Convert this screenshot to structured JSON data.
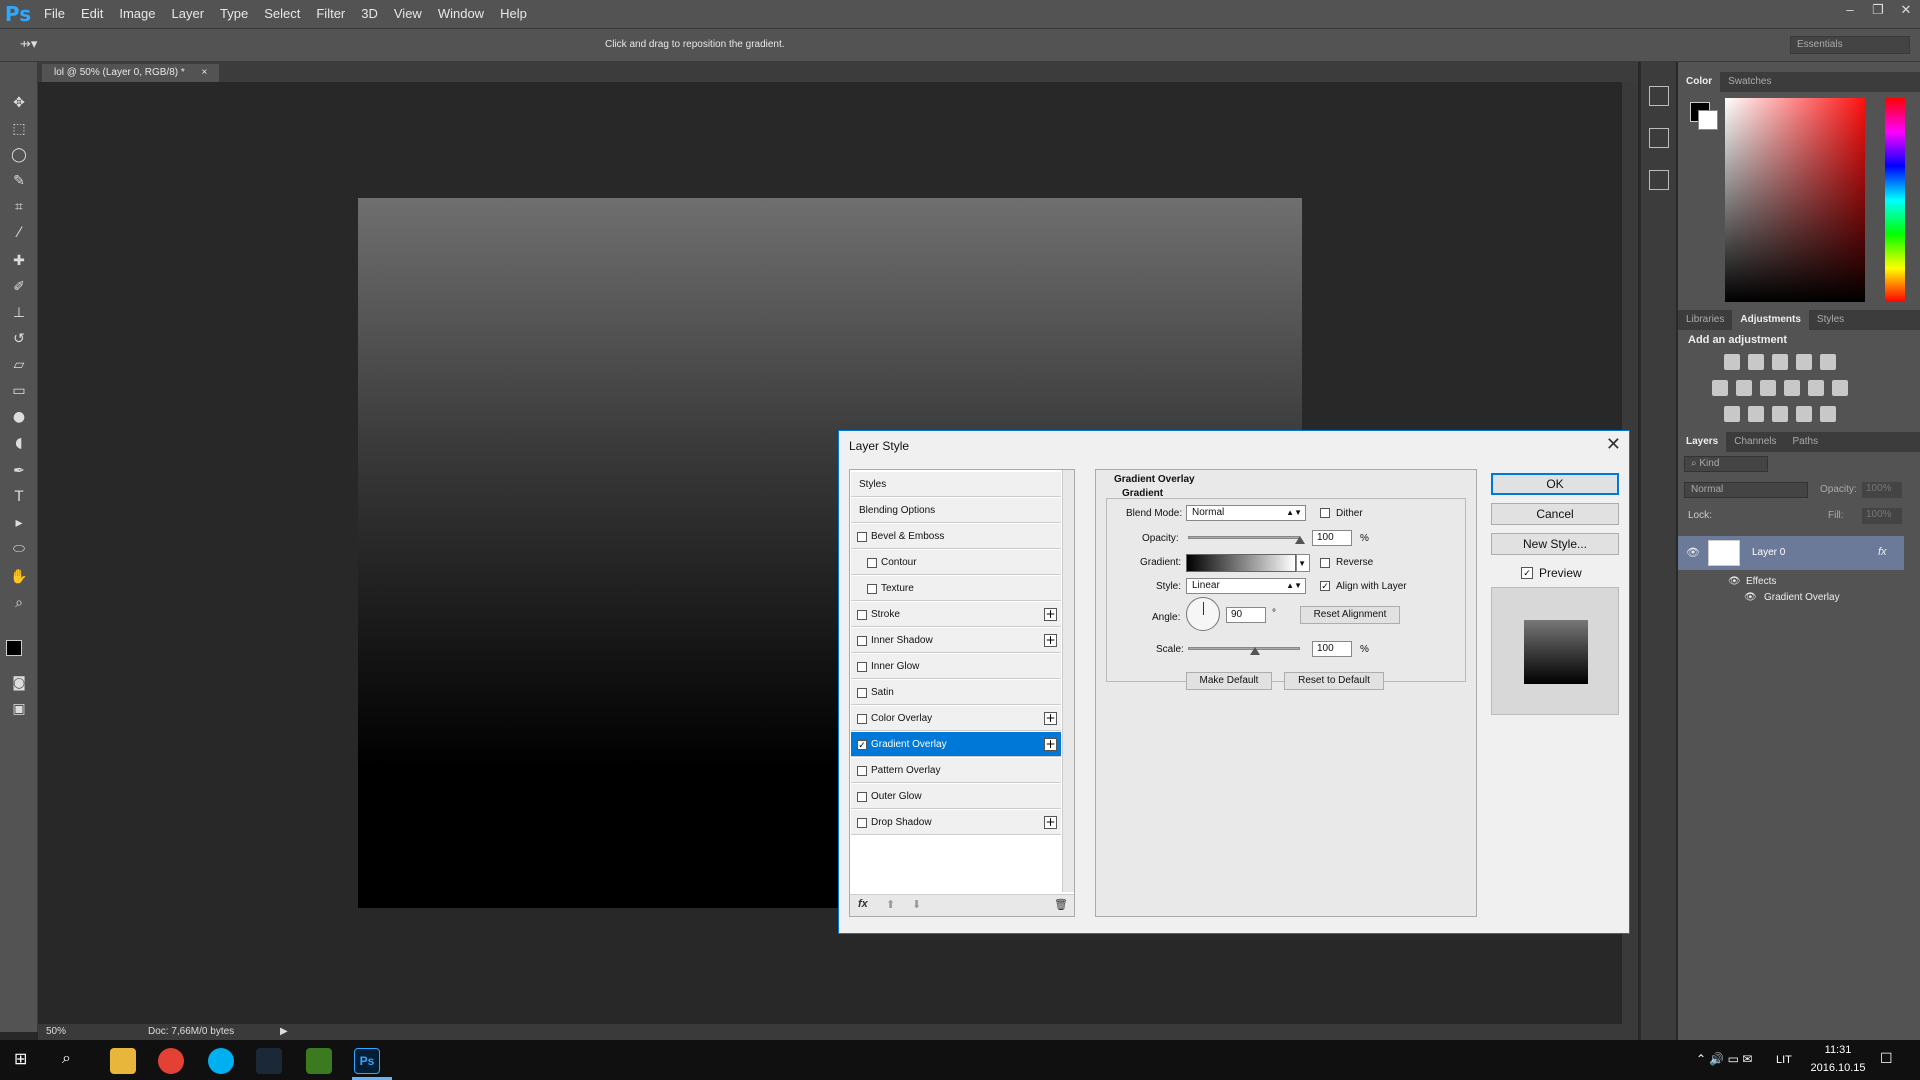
{
  "app": {
    "logo": "Ps",
    "menu": [
      "File",
      "Edit",
      "Image",
      "Layer",
      "Type",
      "Select",
      "Filter",
      "3D",
      "View",
      "Window",
      "Help"
    ],
    "window_controls": [
      "–",
      "❐",
      "✕"
    ]
  },
  "options": {
    "hint": "Click and drag to reposition the gradient.",
    "workspace": "Essentials"
  },
  "document": {
    "tab_title": "lol @ 50% (Layer 0, RGB/8) *",
    "tab_close": "×",
    "zoom": "50%",
    "doc_info": "Doc: 7,66M/0 bytes"
  },
  "color_panel": {
    "tabs": [
      "Color",
      "Swatches"
    ],
    "foreground": "#000000",
    "background": "#ffffff"
  },
  "adjustments_panel": {
    "tabs": [
      "Libraries",
      "Adjustments",
      "Styles"
    ],
    "heading": "Add an adjustment"
  },
  "layers_panel": {
    "tabs": [
      "Layers",
      "Channels",
      "Paths"
    ],
    "filter": "Kind",
    "blend_mode": "Normal",
    "opacity_label": "Opacity:",
    "opacity_value": "100%",
    "lock_label": "Lock:",
    "fill_label": "Fill:",
    "fill_value": "100%",
    "layer_name": "Layer 0",
    "fx": "fx",
    "effects_label": "Effects",
    "effect_name": "Gradient Overlay"
  },
  "taskbar": {
    "language": "LIT",
    "time": "11:31",
    "date": "2016.10.15"
  },
  "dialog": {
    "title": "Layer Style",
    "close": "✕",
    "styles_list": [
      {
        "label": "Styles",
        "checkbox": false,
        "checked": false,
        "plus": false,
        "indent": false
      },
      {
        "label": "Blending Options",
        "checkbox": false,
        "checked": false,
        "plus": false,
        "indent": false
      },
      {
        "label": "Bevel & Emboss",
        "checkbox": true,
        "checked": false,
        "plus": false,
        "indent": false
      },
      {
        "label": "Contour",
        "checkbox": true,
        "checked": false,
        "plus": false,
        "indent": true
      },
      {
        "label": "Texture",
        "checkbox": true,
        "checked": false,
        "plus": false,
        "indent": true
      },
      {
        "label": "Stroke",
        "checkbox": true,
        "checked": false,
        "plus": true,
        "indent": false
      },
      {
        "label": "Inner Shadow",
        "checkbox": true,
        "checked": false,
        "plus": true,
        "indent": false
      },
      {
        "label": "Inner Glow",
        "checkbox": true,
        "checked": false,
        "plus": false,
        "indent": false
      },
      {
        "label": "Satin",
        "checkbox": true,
        "checked": false,
        "plus": false,
        "indent": false
      },
      {
        "label": "Color Overlay",
        "checkbox": true,
        "checked": false,
        "plus": true,
        "indent": false
      },
      {
        "label": "Gradient Overlay",
        "checkbox": true,
        "checked": true,
        "plus": true,
        "indent": false
      },
      {
        "label": "Pattern Overlay",
        "checkbox": true,
        "checked": false,
        "plus": false,
        "indent": false
      },
      {
        "label": "Outer Glow",
        "checkbox": true,
        "checked": false,
        "plus": false,
        "indent": false
      },
      {
        "label": "Drop Shadow",
        "checkbox": true,
        "checked": false,
        "plus": true,
        "indent": false
      }
    ],
    "footer_fx": "fx",
    "settings": {
      "section_title": "Gradient Overlay",
      "group_title": "Gradient",
      "blend_mode_label": "Blend Mode:",
      "blend_mode": "Normal",
      "dither_label": "Dither",
      "opacity_label": "Opacity:",
      "opacity": "100",
      "opacity_slider_fraction": 1.0,
      "percent": "%",
      "gradient_label": "Gradient:",
      "reverse_label": "Reverse",
      "style_label": "Style:",
      "style": "Linear",
      "align_label": "Align with Layer",
      "angle_label": "Angle:",
      "angle": "90",
      "degree": "°",
      "reset_alignment": "Reset Alignment",
      "scale_label": "Scale:",
      "scale": "100",
      "scale_slider_fraction": 0.6,
      "make_default": "Make Default",
      "reset_default": "Reset to Default"
    },
    "buttons": {
      "ok": "OK",
      "cancel": "Cancel",
      "new_style": "New Style...",
      "preview_label": "Preview"
    }
  }
}
